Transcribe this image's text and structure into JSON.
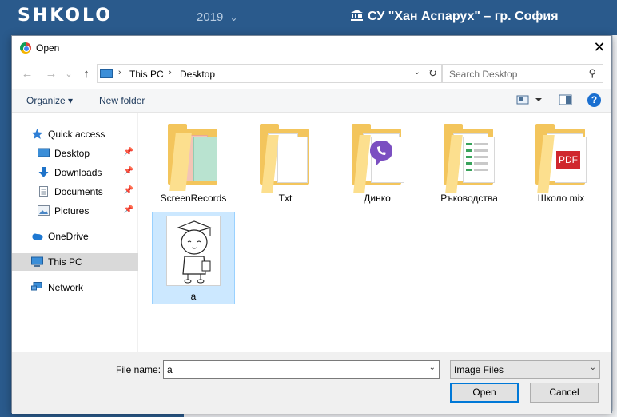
{
  "app": {
    "logo": "SHKOLO",
    "year": "2019",
    "year_chevron": "⌄",
    "school": "СУ \"Хан Аспарух\" – гр. София"
  },
  "dialog": {
    "title": "Open",
    "close": "✕",
    "nav": {
      "back": "←",
      "forward": "→",
      "recent": "⌄",
      "up": "↑"
    },
    "breadcrumb": [
      "This PC",
      "Desktop"
    ],
    "breadcrumb_sep": "›",
    "refresh": "↻",
    "search_placeholder": "Search Desktop",
    "search_glyph": "⚲",
    "dropdown_glyph": "⌄",
    "toolbar": {
      "organize": "Organize ▾",
      "new_folder": "New folder",
      "help": "?"
    },
    "sidebar": {
      "items": [
        {
          "label": "Quick access",
          "icon": "star-icon"
        },
        {
          "label": "Desktop",
          "icon": "desktop-icon",
          "pinned": true
        },
        {
          "label": "Downloads",
          "icon": "download-icon",
          "pinned": true
        },
        {
          "label": "Documents",
          "icon": "document-icon",
          "pinned": true
        },
        {
          "label": "Pictures",
          "icon": "pictures-icon",
          "pinned": true
        },
        {
          "label": "OneDrive",
          "icon": "cloud-icon"
        },
        {
          "label": "This PC",
          "icon": "computer-icon",
          "selected": true
        },
        {
          "label": "Network",
          "icon": "network-icon"
        }
      ],
      "pin_glyph": "📌"
    },
    "files": [
      {
        "label": "ScreenRecords",
        "type": "folder"
      },
      {
        "label": "Txt",
        "type": "folder"
      },
      {
        "label": "Динко",
        "type": "folder"
      },
      {
        "label": "Ръководства",
        "type": "folder"
      },
      {
        "label": "Школо mix",
        "type": "folder",
        "badge": "PDF"
      },
      {
        "label": "a",
        "type": "image",
        "selected": true
      }
    ],
    "footer": {
      "file_name_label": "File name:",
      "file_name_value": "a",
      "file_type": "Image Files",
      "open": "Open",
      "cancel": "Cancel"
    }
  },
  "colors": {
    "app_header": "#2a5a8c",
    "selection": "#cce8ff",
    "accent": "#0078d7",
    "folder": "#f3c55c"
  }
}
